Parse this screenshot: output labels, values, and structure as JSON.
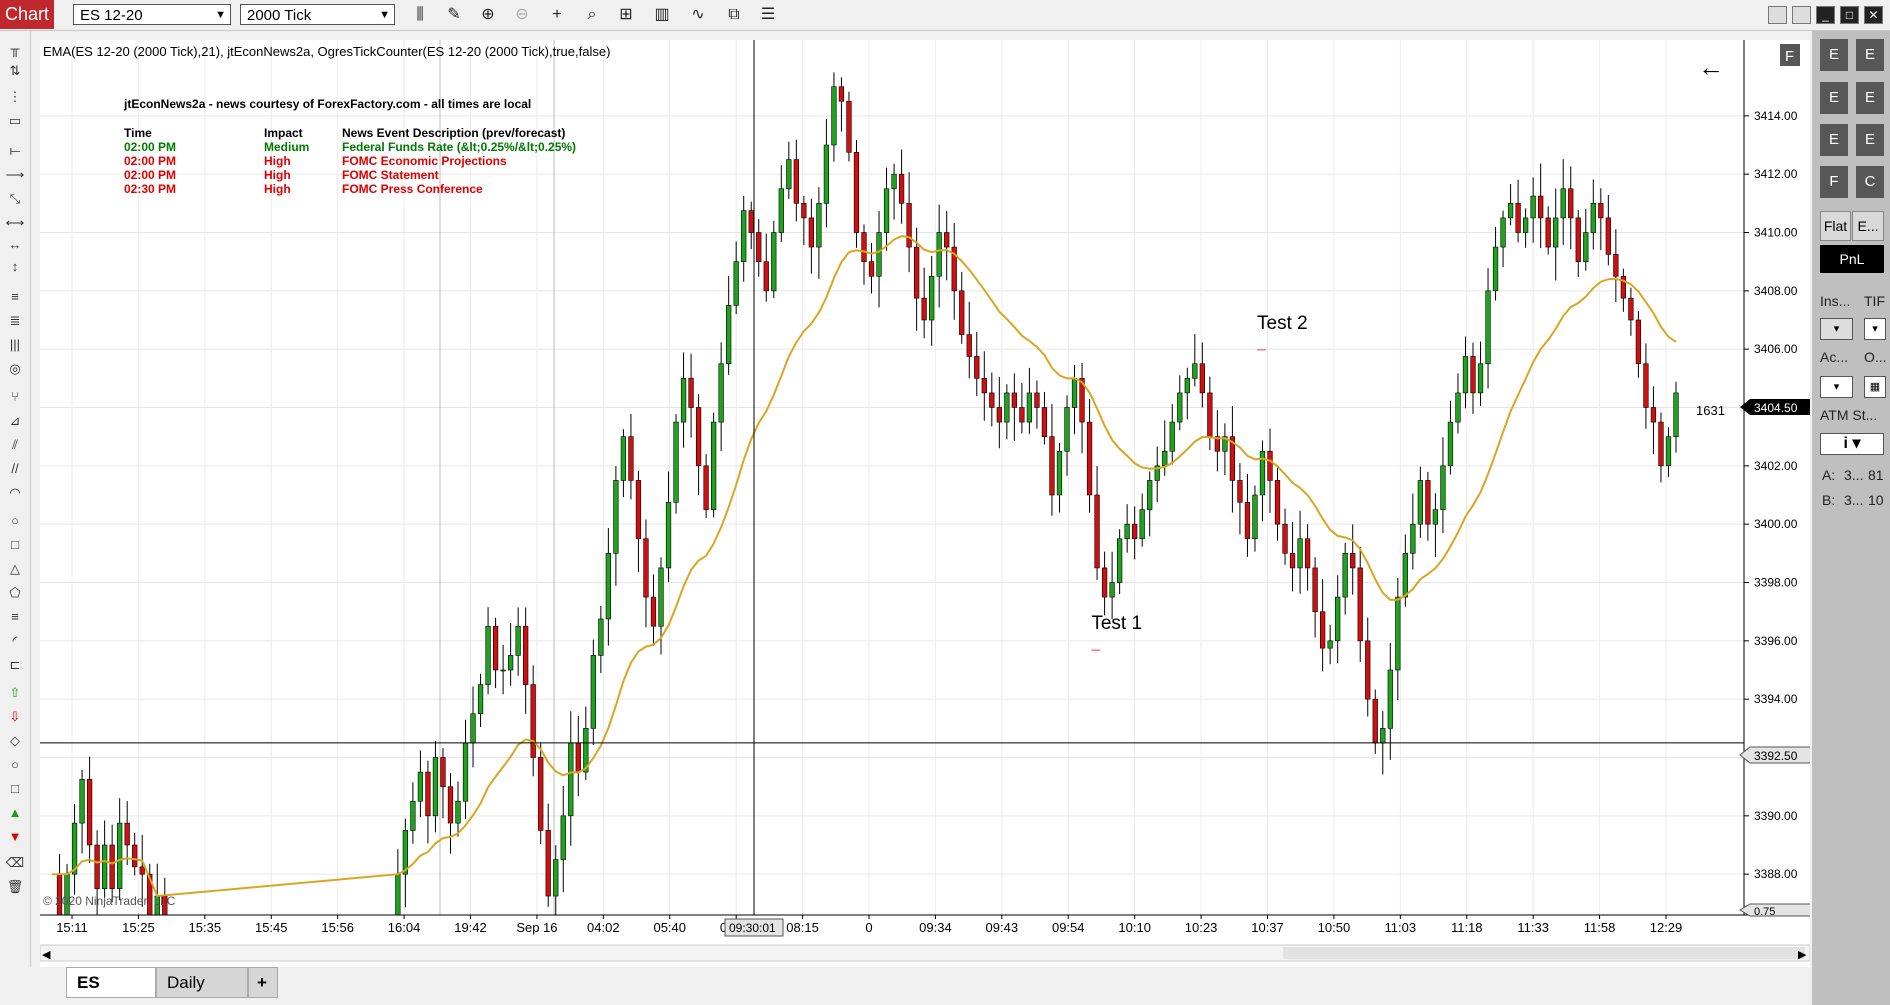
{
  "toolbar": {
    "chart_tab": "Chart",
    "instrument": "ES 12-20",
    "period": "2000 Tick"
  },
  "indicator_label": "EMA(ES 12-20 (2000 Tick),21), jtEconNews2a, OgresTickCounter(ES 12-20 (2000 Tick),true,false)",
  "news": {
    "header": "jtEconNews2a - news courtesy of ForexFactory.com - all times are local",
    "columns": [
      "Time",
      "Impact",
      "News Event Description (prev/forecast)"
    ],
    "rows": [
      {
        "time": "02:00 PM",
        "impact": "Medium",
        "desc": "Federal Funds Rate (&lt;0.25%/&lt;0.25%)",
        "color": "#007a00"
      },
      {
        "time": "02:00 PM",
        "impact": "High",
        "desc": "FOMC Economic Projections",
        "color": "#e00000"
      },
      {
        "time": "02:00 PM",
        "impact": "High",
        "desc": "FOMC Statement",
        "color": "#e00000"
      },
      {
        "time": "02:30 PM",
        "impact": "High",
        "desc": "FOMC Press Conference",
        "color": "#e00000"
      }
    ]
  },
  "copyright": "© 2020 NinjaTrader, LLC",
  "tick_counter": "1631",
  "last_price": "3404.50",
  "crosshair_price": "3392.50",
  "crosshair_time": "09:30:01",
  "cut_price_label": "0.75",
  "back_arrow": "←",
  "f_button": "F",
  "tabs": [
    "ES",
    "Daily",
    "+"
  ],
  "right_panel": {
    "buttons": [
      "E",
      "E",
      "E",
      "E",
      "E",
      "E",
      "F",
      "C"
    ],
    "flat": "Flat",
    "exit": "E...",
    "pnl": "PnL",
    "ins": "Ins...",
    "tif": "TIF",
    "acc": "Ac...",
    "o": "O...",
    "atm": "ATM St...",
    "atm_value": "i",
    "a_label": "A:",
    "a_val1": "3...",
    "a_val2": "81",
    "b_label": "B:",
    "b_val1": "3...",
    "b_val2": "10"
  },
  "chart_data": {
    "type": "candlestick",
    "instrument": "ES 12-20",
    "period": "2000 Tick",
    "ylim": [
      3386.6,
      3416.6
    ],
    "y_ticks": [
      3388,
      3390,
      3392,
      3394,
      3396,
      3398,
      3400,
      3402,
      3404,
      3406,
      3408,
      3410,
      3412,
      3414
    ],
    "x_labels": [
      "15:11",
      "15:25",
      "15:35",
      "15:45",
      "15:56",
      "16:04",
      "19:42",
      "Sep 16",
      "04:02",
      "05:40",
      "07:00",
      "08:15",
      "0",
      "09:34",
      "09:43",
      "09:54",
      "10:10",
      "10:23",
      "10:37",
      "10:50",
      "11:03",
      "11:18",
      "11:33",
      "11:58",
      "12:29"
    ],
    "grid": true,
    "annotations": [
      {
        "text": "Test 1",
        "bar_fraction": 0.64,
        "price": 3396.4
      },
      {
        "text": "Test 2",
        "bar_fraction": 0.742,
        "price": 3406.7
      }
    ],
    "closes": [
      3388.0,
      3386.5,
      3388.0,
      3389.75,
      3391.25,
      3389.0,
      3387.5,
      3389.0,
      3387.5,
      3389.75,
      3389.0,
      3388.25,
      3388.0,
      3386.6,
      3387.25,
      3386.6,
      3386.6,
      3386.6,
      3386.6,
      3386.6,
      3386.6,
      3386.6,
      3386.6,
      3386.6,
      3386.6,
      3386.6,
      3386.6,
      3386.6,
      3386.6,
      3386.6,
      3386.6,
      3386.6,
      3386.6,
      3386.6,
      3386.6,
      3386.6,
      3386.6,
      3386.6,
      3386.6,
      3386.6,
      3386.6,
      3386.6,
      3386.6,
      3386.6,
      3386.6,
      3386.6,
      3388.0,
      3389.5,
      3390.5,
      3391.5,
      3390.0,
      3392.0,
      3391.0,
      3389.75,
      3390.5,
      3392.5,
      3393.5,
      3394.5,
      3396.5,
      3395.0,
      3395.0,
      3395.5,
      3396.5,
      3394.5,
      3392.0,
      3389.5,
      3387.25,
      3388.5,
      3390.0,
      3392.5,
      3391.5,
      3393.0,
      3395.5,
      3396.75,
      3399.0,
      3401.5,
      3403.0,
      3401.5,
      3399.5,
      3397.5,
      3396.5,
      3398.5,
      3400.75,
      3403.5,
      3405.0,
      3404.0,
      3402.0,
      3400.5,
      3403.5,
      3405.5,
      3407.5,
      3409.0,
      3410.75,
      3410.0,
      3409.0,
      3408.0,
      3410.0,
      3411.5,
      3412.5,
      3411.0,
      3410.5,
      3409.5,
      3411.0,
      3413.0,
      3415.0,
      3414.5,
      3412.75,
      3410.0,
      3409.0,
      3408.5,
      3410.0,
      3411.5,
      3412.0,
      3411.0,
      3409.5,
      3407.75,
      3407.0,
      3408.5,
      3410.0,
      3409.5,
      3408.0,
      3406.5,
      3405.75,
      3405.0,
      3404.5,
      3404.0,
      3403.5,
      3404.5,
      3404.0,
      3403.5,
      3404.5,
      3404.0,
      3403.0,
      3401.0,
      3402.5,
      3404.0,
      3405.0,
      3403.5,
      3401.0,
      3398.5,
      3397.5,
      3398.0,
      3399.5,
      3400.0,
      3399.5,
      3400.5,
      3401.5,
      3402.0,
      3402.5,
      3403.5,
      3404.5,
      3405.0,
      3405.5,
      3404.5,
      3403.0,
      3402.5,
      3403.0,
      3401.5,
      3400.75,
      3399.5,
      3401.0,
      3402.5,
      3401.5,
      3400.0,
      3399.0,
      3398.5,
      3399.5,
      3398.5,
      3397.0,
      3395.75,
      3396.0,
      3397.5,
      3399.0,
      3398.5,
      3396.0,
      3394.0,
      3392.5,
      3393.0,
      3395.0,
      3397.5,
      3399.0,
      3400.0,
      3401.5,
      3400.0,
      3400.5,
      3402.0,
      3403.5,
      3404.5,
      3405.75,
      3404.5,
      3405.5,
      3408.0,
      3409.5,
      3410.5,
      3411.0,
      3410.0,
      3410.5,
      3411.25,
      3410.5,
      3409.5,
      3410.5,
      3411.5,
      3410.5,
      3409.0,
      3410.0,
      3411.0,
      3410.5,
      3409.25,
      3408.5,
      3407.75,
      3407.0,
      3405.5,
      3404.0,
      3403.5,
      3402.0,
      3403.0,
      3404.5
    ]
  }
}
